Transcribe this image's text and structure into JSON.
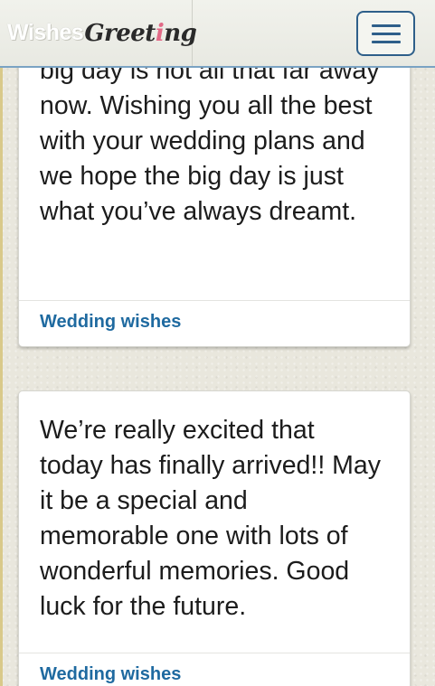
{
  "header": {
    "brand_wishes": "Wishes",
    "brand_greeting_main": "Greet",
    "brand_greeting_accent": "i",
    "brand_greeting_end": "ng",
    "menu_icon": "hamburger-icon"
  },
  "colors": {
    "link": "#1f6aa0",
    "nav_border": "#7aa3c3",
    "toggle": "#2e5f8a",
    "brand_accent": "#e26a87"
  },
  "cards": [
    {
      "text": "big day is not all that far away now. Wishing you all the best with your wedding plans and we hope the big day is just what you’ve always dreamt.",
      "category": "Wedding wishes"
    },
    {
      "text": "We’re really excited that today has finally arrived!! May it be a special and memorable one with lots of wonderful memories. Good luck for the future.",
      "category": "Wedding wishes"
    }
  ]
}
